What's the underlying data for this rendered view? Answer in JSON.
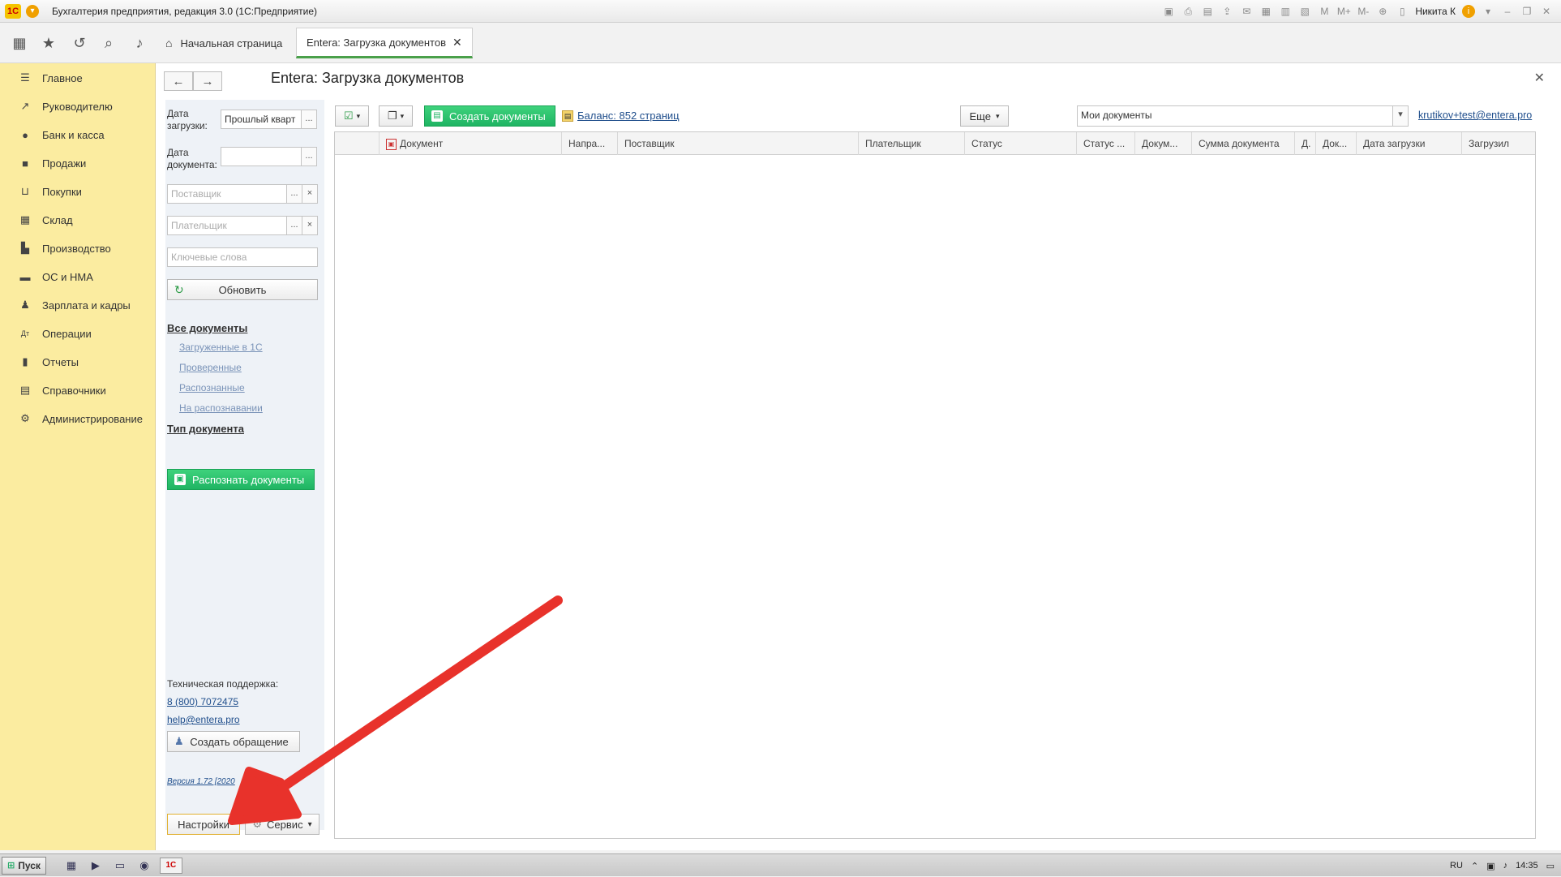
{
  "window": {
    "title": "Бухгалтерия предприятия, редакция 3.0 (1С:Предприятие)",
    "user": "Никита К"
  },
  "tabs": [
    {
      "label": "Начальная страница",
      "icon": "home-icon"
    },
    {
      "label": "Entera: Загрузка документов",
      "icon": ""
    }
  ],
  "sidebar": {
    "items": [
      {
        "label": "Главное",
        "icon": "menu-lines-icon"
      },
      {
        "label": "Руководителю",
        "icon": "trend-icon"
      },
      {
        "label": "Банк и касса",
        "icon": "coin-icon"
      },
      {
        "label": "Продажи",
        "icon": "bag-icon"
      },
      {
        "label": "Покупки",
        "icon": "cart-icon"
      },
      {
        "label": "Склад",
        "icon": "warehouse-icon"
      },
      {
        "label": "Производство",
        "icon": "factory-icon"
      },
      {
        "label": "ОС и НМА",
        "icon": "truck-icon"
      },
      {
        "label": "Зарплата и кадры",
        "icon": "person-icon"
      },
      {
        "label": "Операции",
        "icon": "dtkt-icon"
      },
      {
        "label": "Отчеты",
        "icon": "bar-chart-icon"
      },
      {
        "label": "Справочники",
        "icon": "book-icon"
      },
      {
        "label": "Администрирование",
        "icon": "gear-icon"
      }
    ]
  },
  "form": {
    "title": "Entera: Загрузка документов"
  },
  "filters": {
    "load_date_label": "Дата загрузки:",
    "load_date_value": "Прошлый кварт",
    "doc_date_label": "Дата документа:",
    "doc_date_value": "",
    "supplier_placeholder": "Поставщик",
    "payer_placeholder": "Плательщик",
    "keywords_placeholder": "Ключевые слова",
    "refresh_label": "Обновить",
    "ellipsis": "...",
    "clear": "×"
  },
  "doc_nav": {
    "all_docs": "Все документы",
    "items": [
      "Загруженные в 1С",
      "Проверенные",
      "Распознанные",
      "На распознавании"
    ],
    "doc_type": "Тип документа"
  },
  "recognize_label": "Распознать документы",
  "support": {
    "label": "Техническая поддержка:",
    "phone": "8 (800) 7072475",
    "email": "help@entera.pro",
    "create_ticket": "Создать обращение",
    "version": "Версия 1.72 [2020"
  },
  "bottom_buttons": {
    "settings": "Настройки",
    "service": "Сервис"
  },
  "toolbar": {
    "create_docs": "Создать документы",
    "balance": "Баланс: 852 страниц",
    "more": "Еще",
    "filter_value": "Мои документы",
    "account": "krutikov+test@entera.pro"
  },
  "grid": {
    "columns": [
      "Документ",
      "Напра...",
      "Поставщик",
      "Плательщик",
      "Статус",
      "Статус ...",
      "Докум...",
      "Сумма документа",
      "Д.",
      "Док...",
      "Дата загрузки",
      "Загрузил"
    ]
  },
  "taskbar": {
    "start": "Пуск",
    "lang": "RU",
    "time": "14:35"
  },
  "colors": {
    "sidebar_bg": "#fbeca0",
    "accent_green": "#1fb463",
    "arrow_red": "#e8322b"
  }
}
